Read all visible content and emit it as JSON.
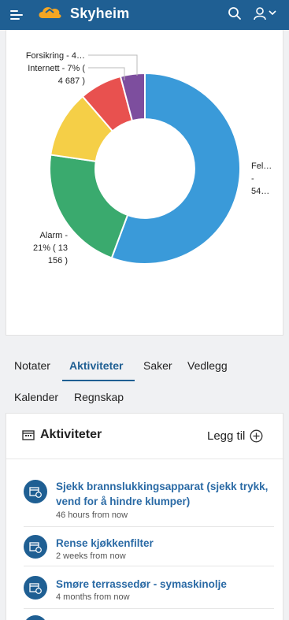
{
  "header": {
    "brand": "Skyheim",
    "icons": [
      "menu-icon",
      "cloud-logo",
      "search-icon",
      "user-icon",
      "chevron-down-icon"
    ]
  },
  "chart_data": {
    "type": "pie",
    "slices": [
      {
        "label_lines": [
          "Fel…",
          "-",
          "54…"
        ],
        "value": 54,
        "color": "#3a9ad9"
      },
      {
        "label_lines": [
          "Alarm -",
          "21% ( 13",
          "156 )"
        ],
        "value": 21,
        "color": "#3aaa6e"
      },
      {
        "label_lines": [],
        "value": 11,
        "color": "#f5cf47"
      },
      {
        "label_lines": [
          "Internett - 7% (",
          "4 687 )"
        ],
        "value": 7,
        "color": "#e8514f"
      },
      {
        "label_lines": [
          "Forsikring - 4…"
        ],
        "value": 4,
        "color": "#7d4e9e"
      }
    ],
    "hole": 0.52
  },
  "tabs": [
    {
      "label": "Notater",
      "active": false
    },
    {
      "label": "Aktiviteter",
      "active": true
    },
    {
      "label": "Saker",
      "active": false
    },
    {
      "label": "Vedlegg",
      "active": false
    },
    {
      "label": "Kalender",
      "active": false
    },
    {
      "label": "Regnskap",
      "active": false
    }
  ],
  "activities": {
    "title": "Aktiviteter",
    "add_label": "Legg til",
    "items": [
      {
        "title": "Sjekk brannslukkingsapparat (sjekk trykk, vend for å hindre klumper)",
        "time": "46 hours from now"
      },
      {
        "title": "Rense kjøkkenfilter",
        "time": "2 weeks from now"
      },
      {
        "title": "Smøre terrassedør - symaskinolje",
        "time": "4 months from now"
      }
    ]
  }
}
